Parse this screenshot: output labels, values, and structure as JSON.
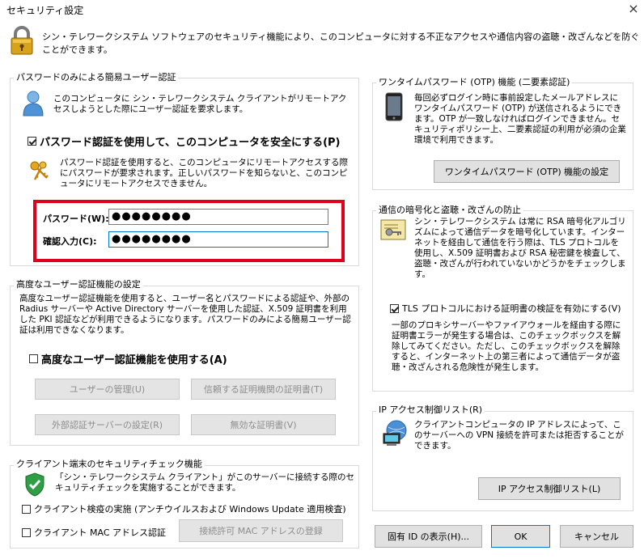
{
  "window": {
    "title": "セキュリティ設定",
    "close_glyph": "×"
  },
  "header": {
    "text": "シン・テレワークシステム ソフトウェアのセキュリティ機能により、このコンピュータに対する不正なアクセスや通信内容の盗聴・改ざんなどを防ぐことができます。"
  },
  "password_auth": {
    "group_title": "パスワードのみによる簡易ユーザー認証",
    "description": "このコンピュータに シン・テレワークシステム クライアントがリモートアクセスしようとした際にユーザー認証を要求します。",
    "enable_checkbox_label": "パスワード認証を使用して、このコンピュータを安全にする(P)",
    "enable_checked": true,
    "note": "パスワード認証を使用すると、このコンピュータにリモートアクセスする際にパスワードが要求されます。正しいパスワードを知らないと、このコンピュータにリモートアクセスできません。",
    "password_label": "パスワード(W):",
    "password_value": "●●●●●●●●",
    "confirm_label": "確認入力(C):",
    "confirm_value": "●●●●●●●●"
  },
  "advanced_auth": {
    "group_title": "高度なユーザー認証機能の設定",
    "description": "高度なユーザー認証機能を使用すると、ユーザー名とパスワードによる認証や、外部の Radius サーバーや Active Directory サーバーを使用した認証、X.509 証明書を利用した PKI 認証などが利用できるようになります。パスワードのみによる簡易ユーザー認証は利用できなくなります。",
    "enable_checkbox_label": "高度なユーザー認証機能を使用する(A)",
    "enable_checked": false,
    "user_mgmt_button": "ユーザーの管理(U)",
    "trusted_ca_button": "信頼する証明機関の証明書(T)",
    "external_server_button": "外部認証サーバーの設定(R)",
    "invalid_cert_button": "無効な証明書(V)"
  },
  "client_check": {
    "group_title": "クライアント端末のセキュリティチェック機能",
    "description": "「シン・テレワークシステム クライアント」がこのサーバーに接続する際のセキュリティチェックを実施することができます。",
    "av_checkbox_label": "クライアント検疫の実施 (アンチウイルスおよび Windows Update 適用検査)",
    "av_checked": false,
    "mac_checkbox_label": "クライアント MAC アドレス認証",
    "mac_checked": false,
    "mac_register_button": "接続許可 MAC アドレスの登録"
  },
  "otp": {
    "group_title": "ワンタイムパスワード (OTP) 機能 (二要素認証)",
    "description": "毎回必ずログイン時に事前設定したメールアドレスにワンタイムパスワード (OTP) が送信されるようにできます。OTP が一致しなければログインできません。セキュリティポリシー上、二要素認証の利用が必須の企業環境で利用できます。",
    "settings_button": "ワンタイムパスワード (OTP) 機能の設定"
  },
  "encryption": {
    "group_title": "通信の暗号化と盗聴・改ざんの防止",
    "description": "シン・テレワークシステム は常に RSA 暗号化アルゴリズムによって通信データを暗号化しています。インターネットを経由して通信を行う際は、TLS プロトコルを使用し、X.509 証明書および RSA 秘密鍵を検査して、盗聴・改ざんが行われていないかどうかをチェックします。",
    "tls_checkbox_label": "TLS プロトコルにおける証明書の検証を有効にする(V)",
    "tls_checked": true,
    "tls_note": "一部のプロキシサーバーやファイアウォールを経由する際に証明書エラーが発生する場合は、このチェックボックスを解除してみてください。ただし、このチェックボックスを解除すると、インターネット上の第三者によって通信データが盗聴・改ざんされる危険性が発生します。"
  },
  "ip_access": {
    "group_title": "IP アクセス制御リスト(R)",
    "description": "クライアントコンピュータの IP アドレスによって、このサーバーへの VPN 接続を許可または拒否することができます。",
    "list_button": "IP アクセス制御リスト(L)"
  },
  "footer": {
    "show_id_button": "固有 ID の表示(H)...",
    "ok_button": "OK",
    "cancel_button": "キャンセル"
  },
  "colors": {
    "highlight_red": "#e0001b",
    "focus_blue": "#0078d7"
  }
}
